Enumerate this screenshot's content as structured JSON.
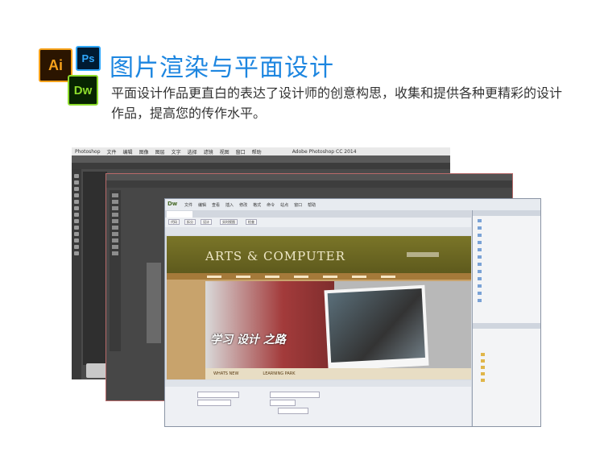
{
  "header": {
    "headline": "图片渲染与平面设计",
    "description": "平面设计作品更直白的表达了设计师的创意构思，收集和提供各种更精彩的设计作品，提高您的传作水平。"
  },
  "app_icons": {
    "ai_label": "Ai",
    "ps_label": "Ps",
    "dw_label": "Dw"
  },
  "colors": {
    "headline": "#1d86e0",
    "ai_accent": "#f7a21b",
    "ps_accent": "#30a8ff",
    "dw_accent": "#8ddc2c"
  },
  "screenshot": {
    "mac_menu": [
      "Photoshop",
      "文件",
      "编辑",
      "图像",
      "图层",
      "文字",
      "选择",
      "滤镜",
      "视图",
      "窗口",
      "帮助"
    ],
    "ps_title": "Adobe Photoshop CC 2014",
    "dw_menu": [
      "文件",
      "编辑",
      "查看",
      "插入",
      "修改",
      "格式",
      "命令",
      "站点",
      "窗口",
      "帮助"
    ],
    "dw_views": [
      "代码",
      "拆分",
      "设计",
      "实时视图",
      "检查"
    ],
    "site_logo": "ARTS & COMPUTER",
    "site_slogan_main": "学习 设计 之路",
    "site_footer": [
      "WHATS NEW",
      "LEARNING PARK"
    ]
  }
}
